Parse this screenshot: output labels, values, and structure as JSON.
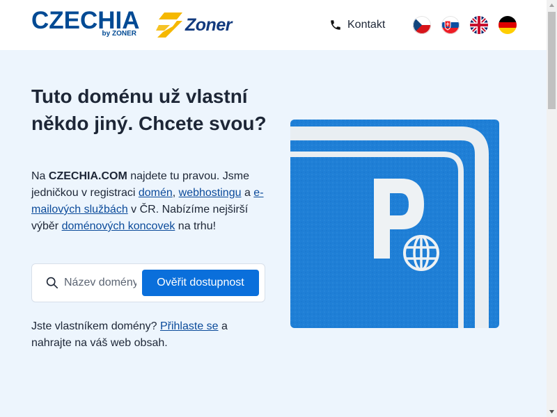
{
  "header": {
    "logo_main": "CZECHIA",
    "logo_sub": "by ZONER",
    "partner_logo": "Zoner",
    "contact_label": "Kontakt",
    "contact_icon": "phone-icon",
    "languages": [
      {
        "code": "cs",
        "icon": "czech-flag-icon"
      },
      {
        "code": "sk",
        "icon": "slovak-flag-icon"
      },
      {
        "code": "en",
        "icon": "uk-flag-icon"
      },
      {
        "code": "de",
        "icon": "german-flag-icon"
      }
    ]
  },
  "hero": {
    "title": "Tuto doménu už vlastní někdo jiný. Chcete svou?",
    "text": {
      "p1": "Na ",
      "brand": "CZECHIA.COM",
      "p2": " najdete tu pravou. Jsme jedničkou v registraci ",
      "link_domains": "domén",
      "p3": ", ",
      "link_webhosting": "webhostingu",
      "p4": " a ",
      "link_email": "e-mailových službách",
      "p5": " v ČR. Nabízíme nejširší výběr ",
      "link_tlds": "doménových koncovek",
      "p6": " na trhu!"
    }
  },
  "search": {
    "placeholder": "Název domény",
    "button_label": "Ověřit dostupnost",
    "icon": "search-icon"
  },
  "owner": {
    "p1": "Jste vlastníkem domény? ",
    "link_login": "Přihlaste se",
    "p2": " a nahrajte na váš web obsah."
  },
  "image": {
    "subject": "parking-sign-with-globe"
  },
  "colors": {
    "brand_blue": "#004a94",
    "zoner_yellow": "#f5b800",
    "button_blue": "#0a6fdb",
    "link_blue": "#0a4a9a",
    "page_bg": "#edf5fd",
    "parking_blue": "#1f7fd6"
  }
}
